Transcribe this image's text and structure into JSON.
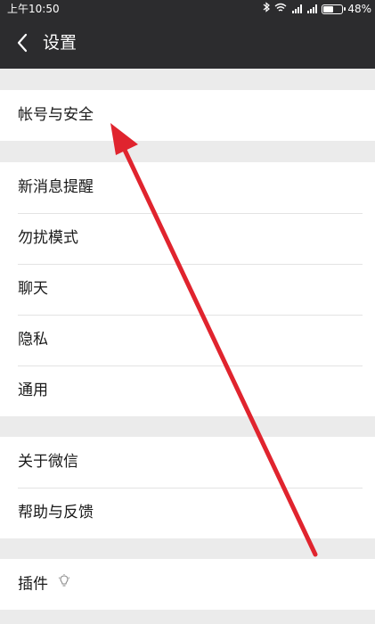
{
  "status_bar": {
    "time": "上午10:50",
    "battery": "48%",
    "battery_level": 0.48,
    "icons": [
      "bluetooth-icon",
      "wifi-icon",
      "signal-icon",
      "signal-icon",
      "battery-icon"
    ]
  },
  "header": {
    "title": "设置",
    "back_icon": "chevron-left-icon"
  },
  "groups": [
    {
      "items": [
        "帐号与安全"
      ]
    },
    {
      "items": [
        "新消息提醒",
        "勿扰模式",
        "聊天",
        "隐私",
        "通用"
      ]
    },
    {
      "items": [
        "关于微信",
        "帮助与反馈"
      ]
    },
    {
      "items": [
        "插件"
      ]
    }
  ],
  "plugin_icon": "lightbulb-icon",
  "annotation": {
    "type": "arrow",
    "color": "#e0242e",
    "points_to": "帐号与安全"
  },
  "colors": {
    "bar_background": "#2c2c2e",
    "page_background": "#ebebeb",
    "row_background": "#ffffff"
  }
}
